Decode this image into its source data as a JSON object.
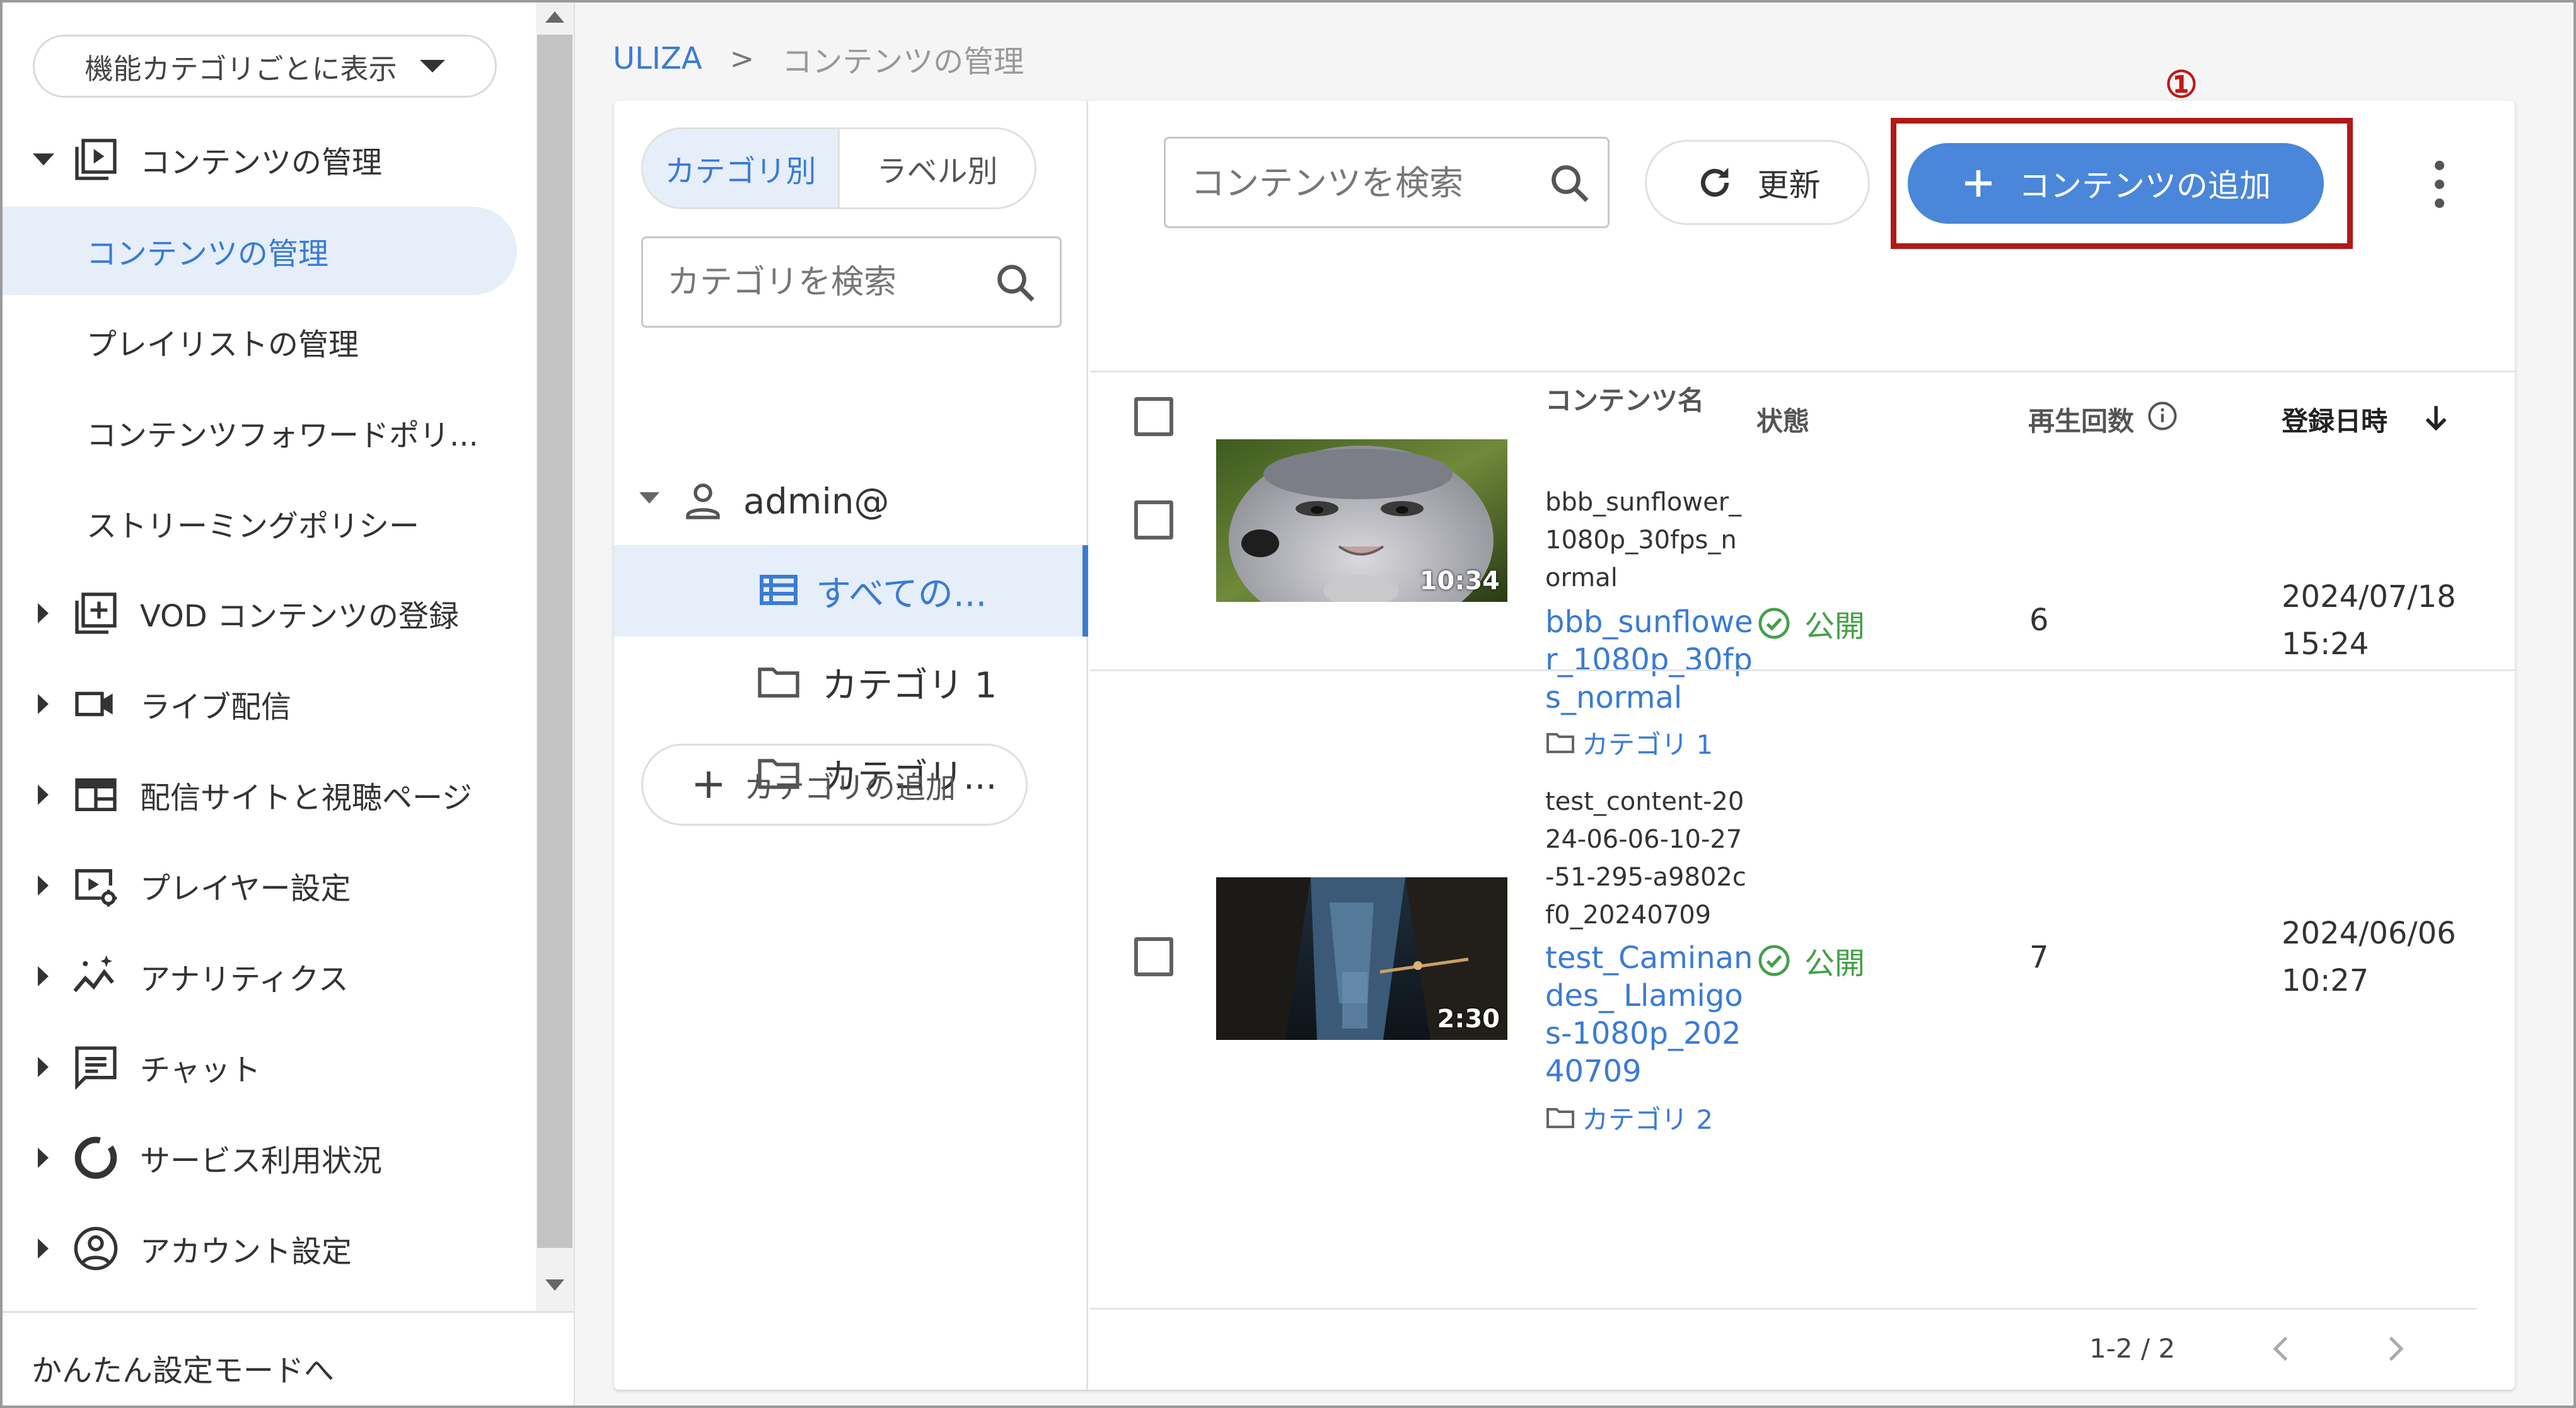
{
  "sidebar": {
    "mode_select": "機能カテゴリごとに表示",
    "section_contents": "コンテンツの管理",
    "sub_items": [
      {
        "label": "コンテンツの管理"
      },
      {
        "label": "プレイリストの管理"
      },
      {
        "label": "コンテンツフォワードポリ..."
      },
      {
        "label": "ストリーミングポリシー"
      }
    ],
    "groups": [
      {
        "label": "VOD コンテンツの登録",
        "icon": "add-box-icon"
      },
      {
        "label": "ライブ配信",
        "icon": "videocam-icon"
      },
      {
        "label": "配信サイトと視聴ページ",
        "icon": "web-icon"
      },
      {
        "label": "プレイヤー設定",
        "icon": "player-settings-icon"
      },
      {
        "label": "アナリティクス",
        "icon": "analytics-icon"
      },
      {
        "label": "チャット",
        "icon": "chat-icon"
      },
      {
        "label": "サービス利用状況",
        "icon": "donut-icon"
      },
      {
        "label": "アカウント設定",
        "icon": "account-circle-icon"
      }
    ],
    "footer": "かんたん設定モードへ"
  },
  "breadcrumb": {
    "root": "ULIZA",
    "separator": ">",
    "current": "コンテンツの管理"
  },
  "category_pane": {
    "tabs": [
      "カテゴリ別",
      "ラベル別"
    ],
    "search_placeholder": "カテゴリを検索",
    "user": "admin@",
    "tree": [
      "すべての...",
      "カテゴリ 1",
      "カテゴリ..."
    ],
    "add_category": "カテゴリの追加"
  },
  "toolbar": {
    "search_placeholder": "コンテンツを検索",
    "refresh": "更新",
    "add_content": "コンテンツの追加",
    "annotation": "①"
  },
  "table": {
    "headers": {
      "name": "コンテンツ名",
      "status": "状態",
      "plays": "再生回数",
      "date": "登録日時"
    },
    "rows": [
      {
        "duration": "10:34",
        "id": "bbb_sunflower_1080p_30fps_normal",
        "title": "bbb_sunflower_1080p_30fps_normal",
        "category": "カテゴリ 1",
        "status": "公開",
        "plays": "6",
        "date": "2024/07/18",
        "time": "15:24"
      },
      {
        "duration": "2:30",
        "id": "test_content-2024-06-06-10-27-51-295-a9802cf0_20240709",
        "title": "test_Caminandes_ Llamigos-1080p_20240709",
        "category": "カテゴリ 2",
        "status": "公開",
        "plays": "7",
        "date": "2024/06/06",
        "time": "10:27"
      }
    ]
  },
  "pagination": {
    "range": "1-2 / 2"
  },
  "colors": {
    "accent": "#4a86d9",
    "highlight": "#b01a1a",
    "success": "#43a047"
  }
}
